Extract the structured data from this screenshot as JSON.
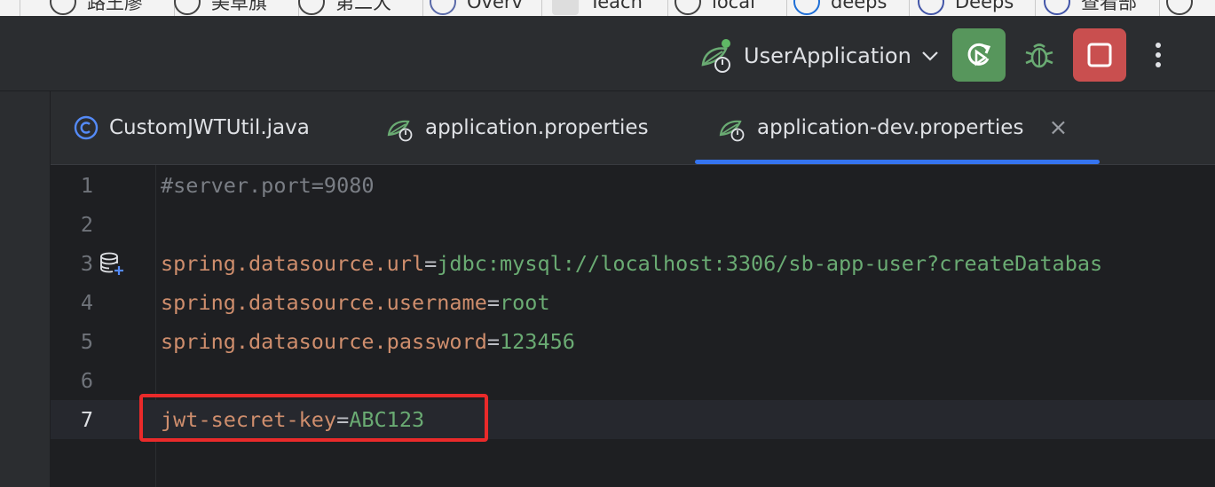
{
  "browser_tabs": [
    {
      "label": "路王廖",
      "icon": "globe-icon"
    },
    {
      "label": "美草旗",
      "icon": "globe-icon"
    },
    {
      "label": "第二大",
      "icon": "globe-icon"
    },
    {
      "label": "Overv",
      "icon": "hexagon-icon"
    },
    {
      "label": "Teach",
      "icon": "note-icon"
    },
    {
      "label": "local",
      "icon": "globe-icon"
    },
    {
      "label": "deeps",
      "icon": "search-icon"
    },
    {
      "label": "Deeps",
      "icon": "deepseek-icon"
    },
    {
      "label": "查看部",
      "icon": "deepseek-icon"
    }
  ],
  "toolbar": {
    "run_config": "UserApplication",
    "rerun_icon": "rerun-icon",
    "debug_icon": "bug-icon",
    "stop_icon": "stop-icon",
    "more_icon": "more-vertical-icon"
  },
  "editor_tabs": [
    {
      "label": "CustomJWTUtil.java",
      "icon": "java-class-icon"
    },
    {
      "label": "application.properties",
      "icon": "spring-properties-icon"
    },
    {
      "label": "application-dev.properties",
      "icon": "spring-properties-icon",
      "active": true
    }
  ],
  "lines": [
    {
      "n": "1",
      "comment": "#server.port=9080"
    },
    {
      "n": "2"
    },
    {
      "n": "3",
      "key": "spring.datasource.url",
      "eq": "=",
      "value": "jdbc:mysql://localhost:3306/sb-app-user?createDatabas"
    },
    {
      "n": "4",
      "key": "spring.datasource.username",
      "eq": "=",
      "value": "root"
    },
    {
      "n": "5",
      "key": "spring.datasource.password",
      "eq": "=",
      "value": "123456"
    },
    {
      "n": "6"
    },
    {
      "n": "7",
      "key": "jwt-secret-key",
      "eq": "=",
      "value": "ABC123"
    }
  ],
  "colors": {
    "accent": "#3574f0",
    "rerun": "#57965c",
    "stop": "#c94f4f",
    "key": "#cf8e6d",
    "value": "#6aab73",
    "highlight": "#ea2a2a"
  }
}
